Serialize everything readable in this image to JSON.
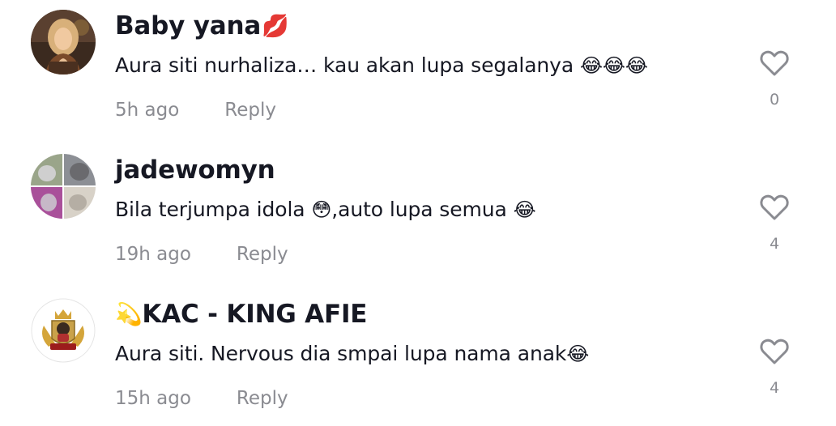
{
  "comments": [
    {
      "username": "Baby yana",
      "username_emoji": "💋",
      "text": "Aura siti nurhaliza… kau akan lupa segalanya ",
      "text_emoji": "😂😂😂",
      "time": "5h ago",
      "reply_label": "Reply",
      "likes": "0",
      "avatar": "woman-portrait"
    },
    {
      "username": "jadewomyn",
      "username_emoji": "",
      "text_part1": "Bila terjumpa idola ",
      "text_emoji1": "😳",
      "text_part2": ",auto lupa semua ",
      "text_emoji2": "😂",
      "time": "19h ago",
      "reply_label": "Reply",
      "likes": "4",
      "avatar": "cat-collage"
    },
    {
      "username_lead_emoji": "💫",
      "username": "KAC - KING AFIE",
      "text": "Aura siti. Nervous dia smpai lupa nama anak",
      "text_emoji": "😂",
      "time": "15h ago",
      "reply_label": "Reply",
      "likes": "4",
      "avatar": "crest-logo"
    }
  ],
  "icons": {
    "like": "heart-outline-icon"
  },
  "colors": {
    "text": "#161823",
    "muted": "#8a8b91",
    "heart_stroke": "#8a8b91"
  }
}
